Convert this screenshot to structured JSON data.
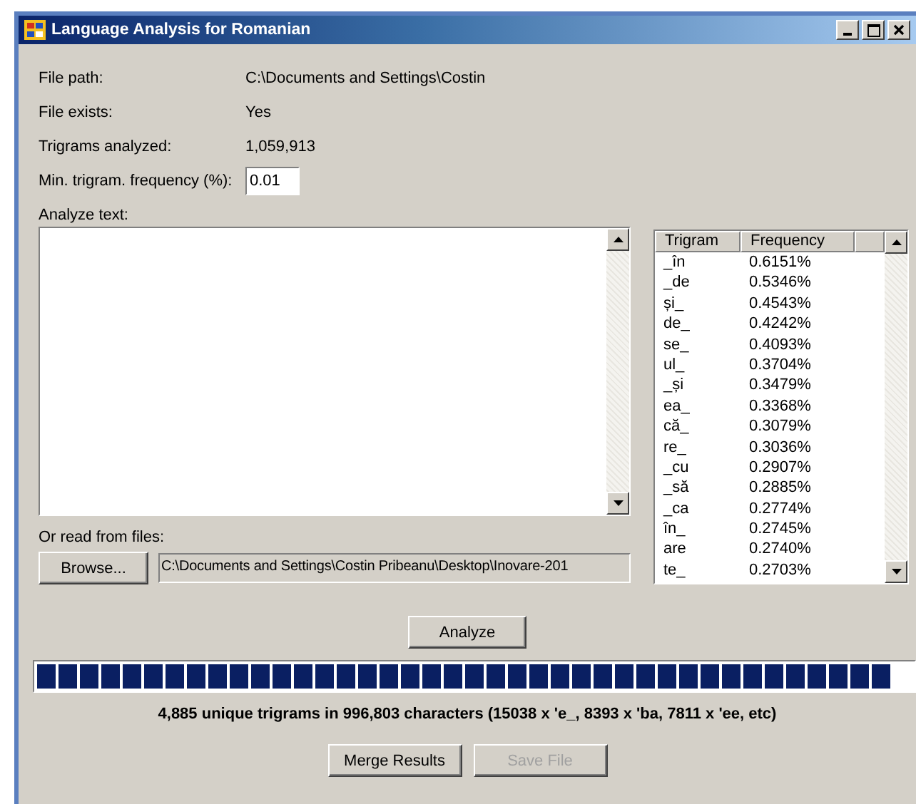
{
  "window": {
    "title": "Language Analysis for Romanian"
  },
  "info": [
    {
      "label": "File path:",
      "value": "C:\\Documents and Settings\\Costin"
    },
    {
      "label": "File exists:",
      "value": "Yes"
    },
    {
      "label": "Trigrams analyzed:",
      "value": "1,059,913"
    }
  ],
  "min_frequency": {
    "label": "Min. trigram. frequency (%):",
    "value": "0.01"
  },
  "analyze_text": {
    "label": "Analyze text:"
  },
  "files": {
    "label": "Or read from files:",
    "browse": "Browse...",
    "path": "C:\\Documents and Settings\\Costin Pribeanu\\Desktop\\Inovare-201"
  },
  "table": {
    "columns": [
      "Trigram",
      "Frequency"
    ],
    "rows": [
      [
        "_în",
        "0.6151%"
      ],
      [
        "_de",
        "0.5346%"
      ],
      [
        "și_",
        "0.4543%"
      ],
      [
        "de_",
        "0.4242%"
      ],
      [
        "se_",
        "0.4093%"
      ],
      [
        "ul_",
        "0.3704%"
      ],
      [
        "_și",
        "0.3479%"
      ],
      [
        "ea_",
        "0.3368%"
      ],
      [
        "că_",
        "0.3079%"
      ],
      [
        "re_",
        "0.3036%"
      ],
      [
        "_cu",
        "0.2907%"
      ],
      [
        "_să",
        "0.2885%"
      ],
      [
        "_ca",
        "0.2774%"
      ],
      [
        "în_",
        "0.2745%"
      ],
      [
        "are",
        "0.2740%"
      ],
      [
        "te_",
        "0.2703%"
      ]
    ]
  },
  "analyze_button": "Analyze",
  "summary": "4,885 unique trigrams in 996,803 characters (15038 x 'e_, 8393 x 'ba, 7811 x 'ee, etc)",
  "buttons": [
    {
      "label": "Merge Results",
      "disabled": false
    },
    {
      "label": "Save File",
      "disabled": true
    }
  ]
}
